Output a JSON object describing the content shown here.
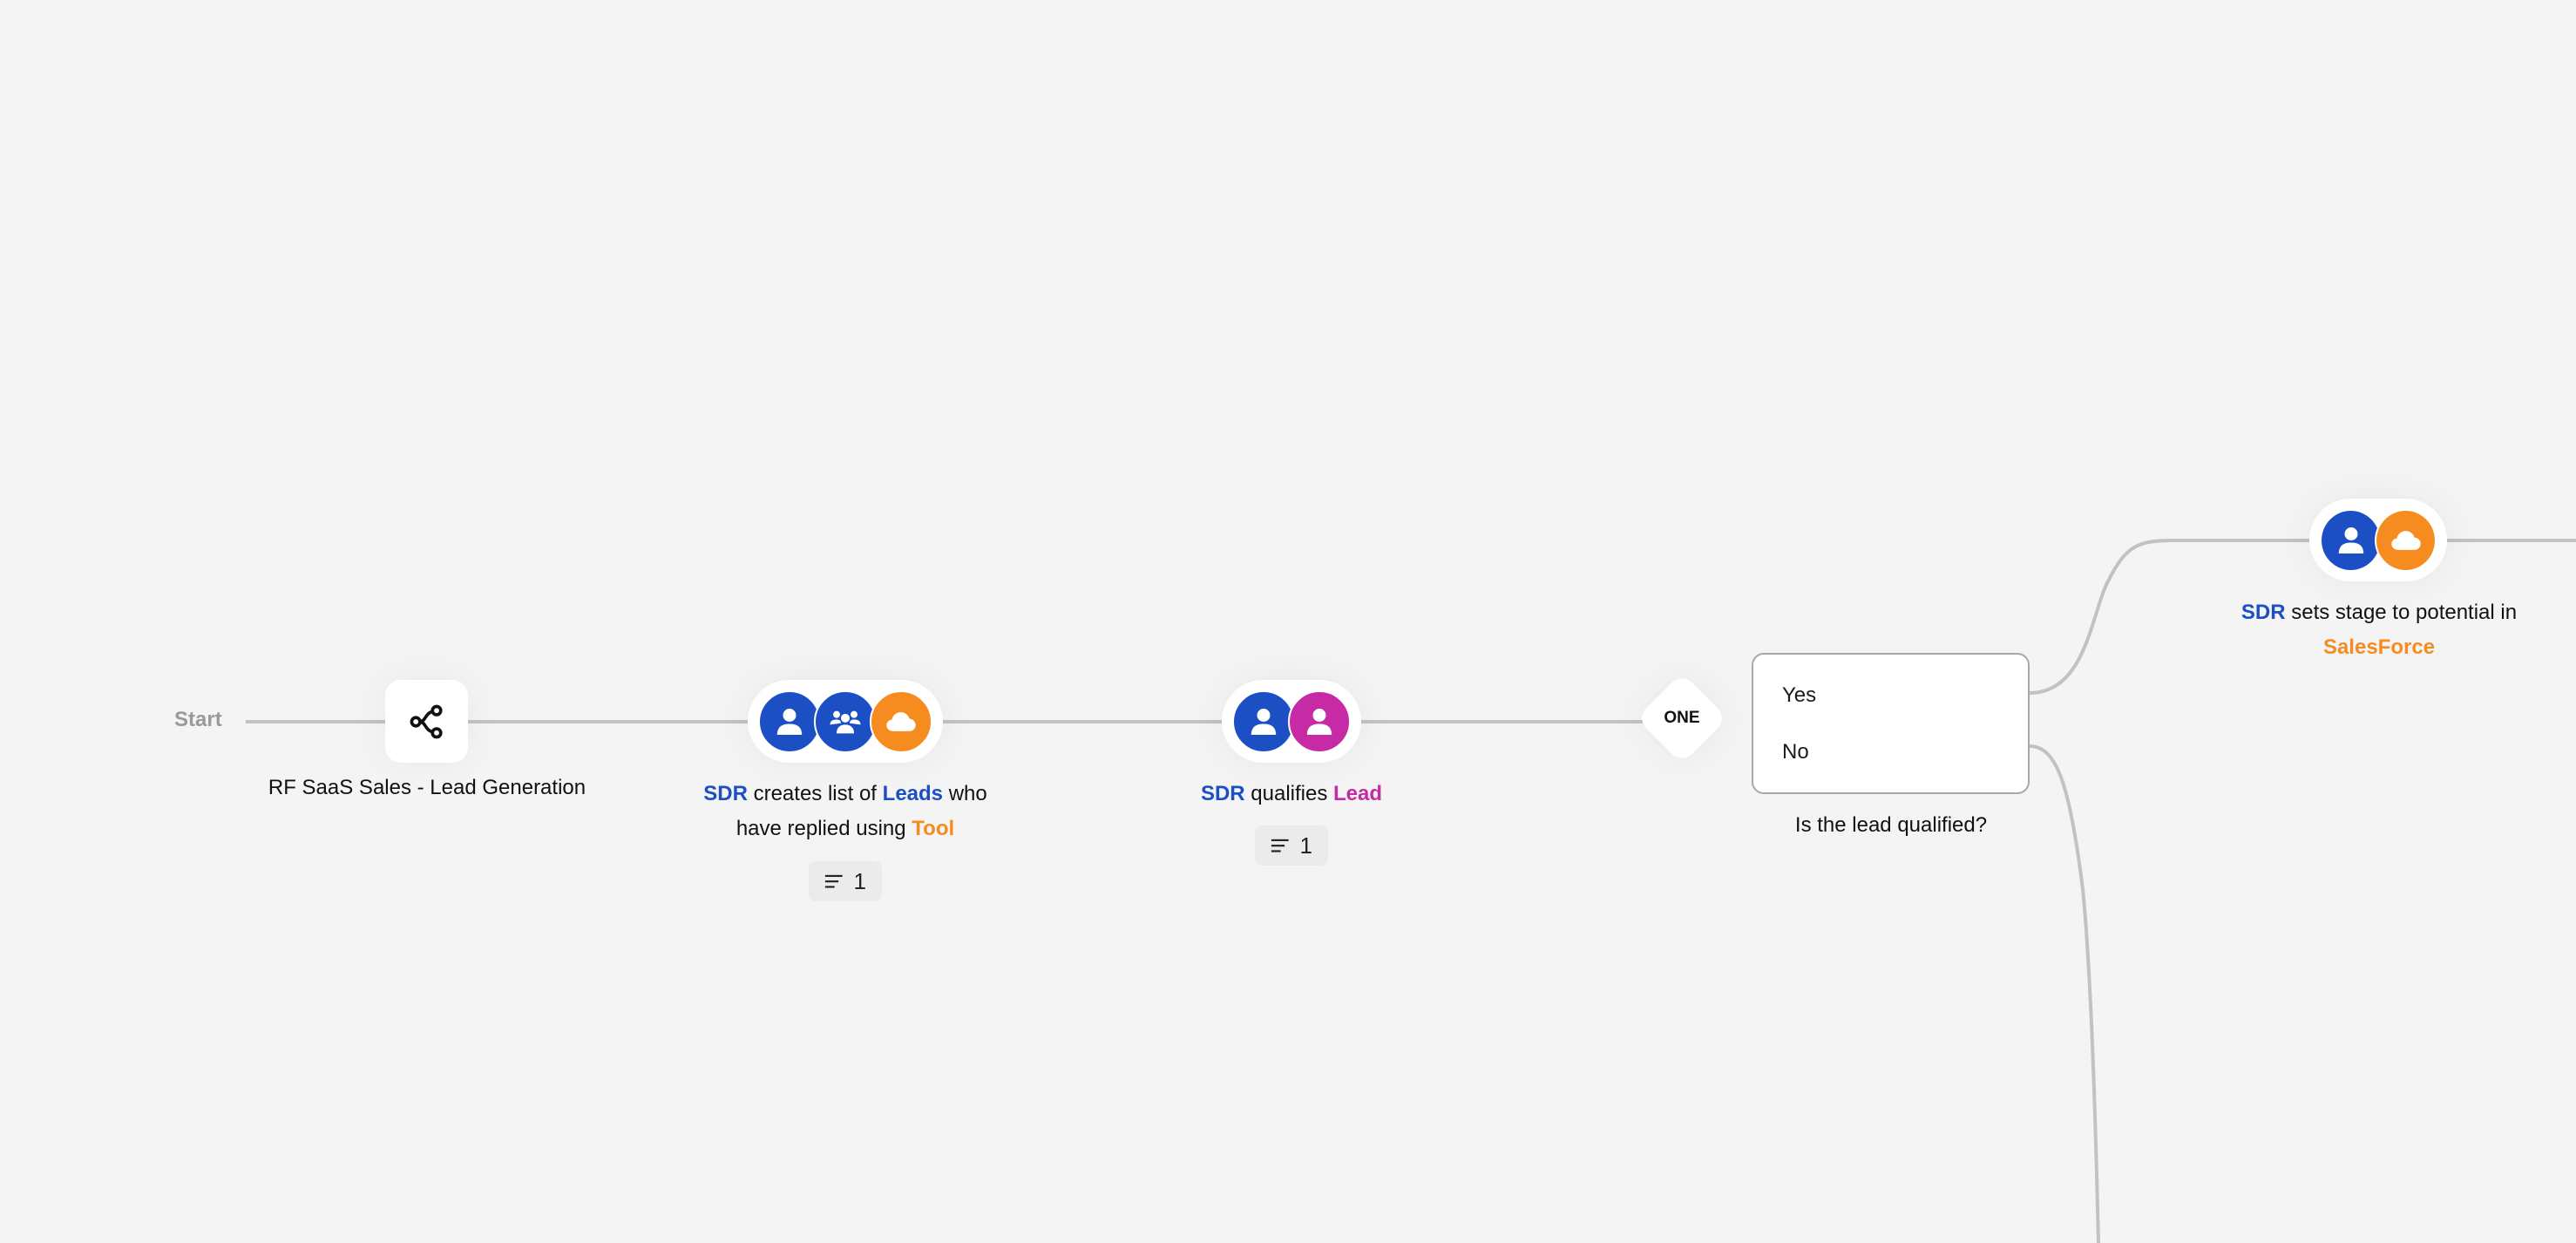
{
  "canvas": {
    "start_label": "Start",
    "colors": {
      "background": "#f4f4f4",
      "edge": "#c2c2c2",
      "role_blue": "#1d4fc4",
      "tool_orange": "#f68c1f",
      "lead_magenta": "#c62aa5",
      "badge_bg": "#ebebeb"
    }
  },
  "nodes": {
    "process": {
      "icon": "share-icon",
      "label": "RF SaaS Sales - Lead Generation"
    },
    "create_list": {
      "avatars": [
        {
          "icon": "person-icon",
          "color": "blue"
        },
        {
          "icon": "group-icon",
          "color": "blue"
        },
        {
          "icon": "cloud-icon",
          "color": "orange"
        }
      ],
      "label": {
        "line1": [
          {
            "text": "SDR",
            "style": "blue"
          },
          {
            "text": " creates list of ",
            "style": "plain"
          },
          {
            "text": "Leads",
            "style": "blue"
          },
          {
            "text": " who",
            "style": "plain"
          }
        ],
        "line2": [
          {
            "text": "have replied using ",
            "style": "plain"
          },
          {
            "text": "Tool",
            "style": "orange"
          }
        ]
      },
      "badge": {
        "icon": "notes-icon",
        "count": "1"
      }
    },
    "qualify": {
      "avatars": [
        {
          "icon": "person-icon",
          "color": "blue"
        },
        {
          "icon": "person-icon",
          "color": "magenta"
        }
      ],
      "label": {
        "line1": [
          {
            "text": "SDR",
            "style": "blue"
          },
          {
            "text": " qualifies ",
            "style": "plain"
          },
          {
            "text": "Lead",
            "style": "magenta"
          }
        ]
      },
      "badge": {
        "icon": "notes-icon",
        "count": "1"
      }
    },
    "gateway": {
      "type_label": "ONE"
    },
    "decision": {
      "options": [
        "Yes",
        "No"
      ],
      "question": "Is the lead qualified?"
    },
    "set_stage": {
      "avatars": [
        {
          "icon": "person-icon",
          "color": "blue"
        },
        {
          "icon": "cloud-icon",
          "color": "orange"
        }
      ],
      "label": {
        "line1": [
          {
            "text": "SDR",
            "style": "blue"
          },
          {
            "text": " sets stage to potential in",
            "style": "plain"
          }
        ],
        "line2": [
          {
            "text": "SalesForce",
            "style": "orange"
          }
        ]
      }
    }
  }
}
